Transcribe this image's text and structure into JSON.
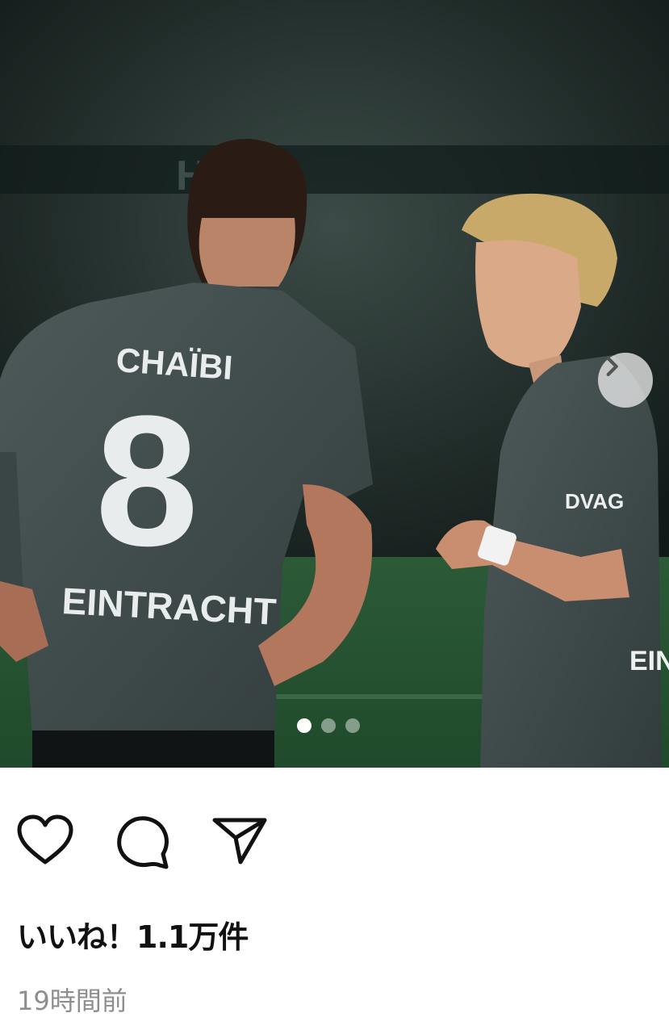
{
  "post": {
    "image": {
      "description_icon": "photo",
      "player_left": {
        "name": "CHAÏBI",
        "number": "8",
        "sponsor": "EINTRACHT"
      },
      "player_right": {
        "sponsor": "DVAG",
        "sleeve": "EINTR"
      },
      "banner": "HLER"
    },
    "carousel": {
      "total": 3,
      "current": 1,
      "next_icon": "chevron-right-icon"
    },
    "actions": {
      "like_icon": "heart-icon",
      "comment_icon": "comment-bubble-icon",
      "share_icon": "paper-plane-icon"
    },
    "likes_text": "いいね！1.1万件",
    "timestamp": "19時間前"
  }
}
